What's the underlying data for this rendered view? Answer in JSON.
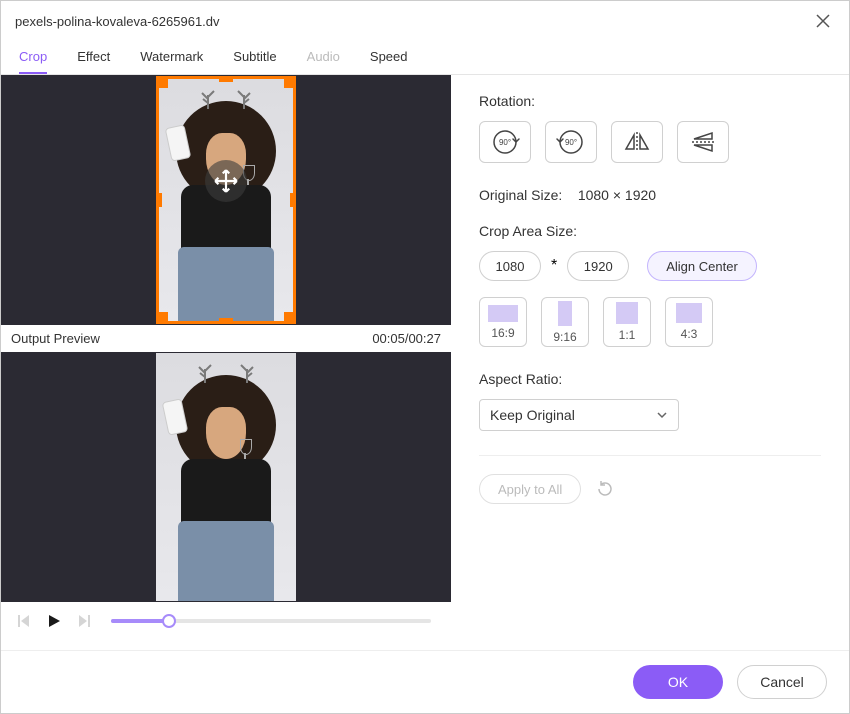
{
  "title": "pexels-polina-kovaleva-6265961.dv",
  "tabs": [
    {
      "label": "Crop",
      "active": true,
      "disabled": false
    },
    {
      "label": "Effect",
      "active": false,
      "disabled": false
    },
    {
      "label": "Watermark",
      "active": false,
      "disabled": false
    },
    {
      "label": "Subtitle",
      "active": false,
      "disabled": false
    },
    {
      "label": "Audio",
      "active": false,
      "disabled": true
    },
    {
      "label": "Speed",
      "active": false,
      "disabled": false
    }
  ],
  "preview": {
    "output_label": "Output Preview",
    "time": "00:05/00:27"
  },
  "panel": {
    "rotation_label": "Rotation:",
    "original_size_label": "Original Size:",
    "original_size_value": "1080 × 1920",
    "crop_area_label": "Crop Area Size:",
    "crop_width": "1080",
    "crop_mult": "*",
    "crop_height": "1920",
    "align_center": "Align Center",
    "ratios": [
      {
        "label": "16:9"
      },
      {
        "label": "9:16"
      },
      {
        "label": "1:1"
      },
      {
        "label": "4:3"
      }
    ],
    "aspect_label": "Aspect Ratio:",
    "aspect_value": "Keep Original",
    "apply_all": "Apply to All"
  },
  "footer": {
    "ok": "OK",
    "cancel": "Cancel"
  }
}
